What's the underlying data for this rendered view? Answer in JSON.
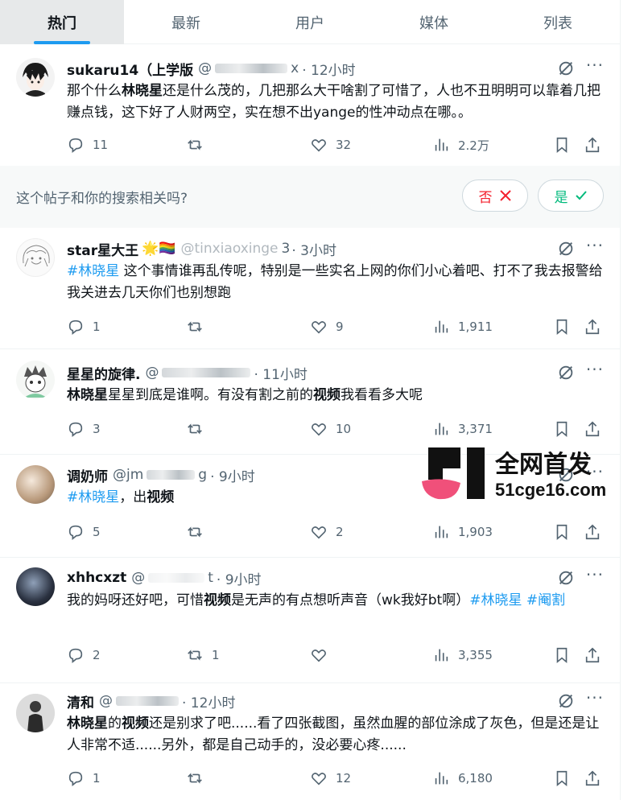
{
  "tabs": [
    {
      "label": "热门",
      "active": true
    },
    {
      "label": "最新",
      "active": false
    },
    {
      "label": "用户",
      "active": false
    },
    {
      "label": "媒体",
      "active": false
    },
    {
      "label": "列表",
      "active": false
    }
  ],
  "survey": {
    "question": "这个帖子和你的搜索相关吗?",
    "no_label": "否",
    "yes_label": "是"
  },
  "watermark": {
    "line1": "全网首发",
    "line2": "51cge16.com"
  },
  "colors": {
    "accent": "#1d9bf0",
    "text": "#0f1419",
    "muted": "#536471",
    "no": "#f4212e",
    "yes": "#00ba7c",
    "watermark_pink": "#f0507a"
  },
  "posts": [
    {
      "name": "sukaru14（上学版",
      "handle": "@",
      "handle_end": "x",
      "time": "· 12小时",
      "segments": [
        {
          "t": "那个什么"
        },
        {
          "t": "林晓星",
          "b": true
        },
        {
          "t": "还是什么茂的，几把那么大干啥割了可惜了，人也不丑明明可以靠着几把赚点钱，这下好了人财两空，实在想不出yange的性冲动点在哪。。"
        }
      ],
      "replies": "11",
      "reposts": "",
      "likes": "32",
      "views": "2.2万",
      "avatar_icon": "anime-boy-avatar"
    },
    {
      "name": "star星大王",
      "emoji": "🌟🏳️‍🌈",
      "handle": "@tinxiaoxinge",
      "handle_end": "3",
      "time": "· 3小时",
      "segments": [
        {
          "t": "#林晓星",
          "tag": true
        },
        {
          "t": " 这个事情谁再乱传呢，特别是一些实名上网的你们小心着吧、打不了我去报警给我关进去几天你们也别想跑"
        }
      ],
      "replies": "1",
      "reposts": "",
      "likes": "9",
      "views": "1,911",
      "avatar_icon": "sketch-avatar"
    },
    {
      "name": "星星的旋律.",
      "handle": "@",
      "handle_end": "",
      "time": "· 11小时",
      "segments": [
        {
          "t": "林晓星",
          "b": true
        },
        {
          "t": "星星到底是谁啊。有没有割之前的"
        },
        {
          "t": "视频",
          "b": true
        },
        {
          "t": "我看看多大呢"
        }
      ],
      "replies": "3",
      "reposts": "",
      "likes": "10",
      "views": "3,371",
      "avatar_icon": "cartoon-avatar"
    },
    {
      "name": "调奶师",
      "handle": "@jm",
      "handle_end": "g",
      "time": "· 9小时",
      "segments": [
        {
          "t": "#林晓星",
          "tag": true
        },
        {
          "t": "，出"
        },
        {
          "t": "视频",
          "b": true
        }
      ],
      "replies": "5",
      "reposts": "",
      "likes": "2",
      "views": "1,903",
      "avatar_icon": "photo-avatar"
    },
    {
      "name": "xhhcxzt",
      "handle": "@",
      "handle_end": "t",
      "time": "· 9小时",
      "segments": [
        {
          "t": "我的妈呀还好吧，可惜"
        },
        {
          "t": "视频",
          "b": true
        },
        {
          "t": "是无声的有点想听声音（wk我好bt啊）"
        },
        {
          "t": "#林晓星",
          "tag": true
        },
        {
          "t": " "
        },
        {
          "t": "#阉割",
          "tag": true
        }
      ],
      "replies": "2",
      "reposts": "1",
      "likes": "",
      "views": "3,355",
      "avatar_icon": "dark-photo-avatar"
    },
    {
      "name": "清和",
      "handle": "@",
      "handle_end": "",
      "time": "· 12小时",
      "segments": [
        {
          "t": "林晓星",
          "b": true
        },
        {
          "t": "的"
        },
        {
          "t": "视频",
          "b": true
        },
        {
          "t": "还是别求了吧......看了四张截图，虽然血腥的部位涂成了灰色，但是还是让人非常不适......另外，都是自己动手的，没必要心疼......"
        }
      ],
      "replies": "1",
      "reposts": "",
      "likes": "12",
      "views": "6,180",
      "avatar_icon": "person-avatar"
    }
  ]
}
